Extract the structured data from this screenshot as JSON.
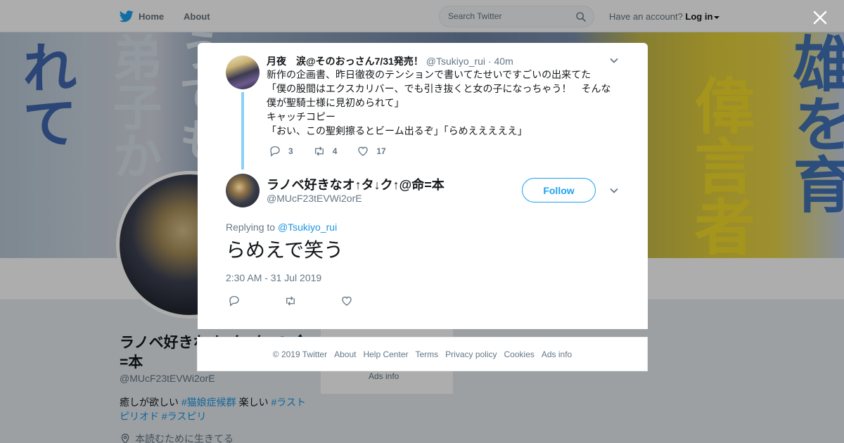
{
  "nav": {
    "home_label": "Home",
    "about_label": "About",
    "search_placeholder": "Search Twitter",
    "account_prompt": "Have an account?",
    "login_label": "Log in"
  },
  "profile": {
    "name": "ラノベ好きなオ↑タ↓ク↑@ 命=本",
    "handle": "@MUcF23tEVWi2orE",
    "bio_text_1": "癒しが欲しい ",
    "bio_tag_1": "#猫娘症候群",
    "bio_text_2": " 楽しい ",
    "bio_tag_2": "#ラストピリオド",
    "bio_tag_3": " #ラスピリ",
    "location": "本読むために生きてる",
    "side_card_ads": "Ads info"
  },
  "original_tweet": {
    "display_name": "月夜　涙@そのおっさん7/31発売！",
    "handle": "@Tsukiyo_rui",
    "time": "40m",
    "separator": " · ",
    "text": "新作の企画書、昨日徹夜のテンションで書いてたせいですごいの出来てた\n「僕の股間はエクスカリバー、でも引き抜くと女の子になっちゃう！　そんな僕が聖騎士様に見初められて」\nキャッチコピー\n「おい、この聖剣擦るとビーム出るぞ」「らめえええええ」",
    "reply_count": "3",
    "retweet_count": "4",
    "like_count": "17"
  },
  "reply_tweet": {
    "display_name": "ラノベ好きなオ↑タ↓ク↑@命=本",
    "handle": "@MUcF23tEVWi2orE",
    "follow_label": "Follow",
    "replying_prefix": "Replying to ",
    "replying_to": "@Tsukiyo_rui",
    "text": "らめえで笑う",
    "timestamp": "2:30 AM - 31 Jul 2019"
  },
  "footer": {
    "links": [
      "© 2019 Twitter",
      "About",
      "Help Center",
      "Terms",
      "Privacy policy",
      "Cookies",
      "Ads info"
    ]
  },
  "colors": {
    "accent": "#1da1f2",
    "link": "#1b95e0",
    "thread_line": "#8bd0f5",
    "muted_text": "#657786"
  }
}
